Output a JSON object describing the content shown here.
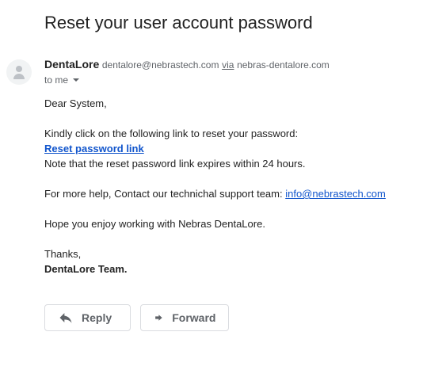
{
  "email": {
    "subject": "Reset your user account password",
    "sender": {
      "name": "DentaLore",
      "email": "dentalore@nebrastech.com",
      "via_label": "via",
      "via_domain": "nebras-dentalore.com"
    },
    "recipient_label": "to me",
    "body": {
      "greeting": "Dear System,",
      "instruction": "Kindly click on the following link to reset your password:",
      "reset_link_text": "Reset password link",
      "expiry_note": "Note that the reset password link expires within 24 hours.",
      "help_prefix": "For more help, Contact our technichal support team: ",
      "help_email": "info@nebrastech.com",
      "closing_wish": "Hope you enjoy working with Nebras DentaLore.",
      "thanks": "Thanks,",
      "signature": "DentaLore Team."
    }
  },
  "actions": {
    "reply_label": "Reply",
    "reply_icon": "reply-icon",
    "forward_label": "Forward",
    "forward_icon": "forward-icon"
  },
  "colors": {
    "link": "#1155cc",
    "muted_text": "#5f6368",
    "button_border": "#dadce0"
  }
}
